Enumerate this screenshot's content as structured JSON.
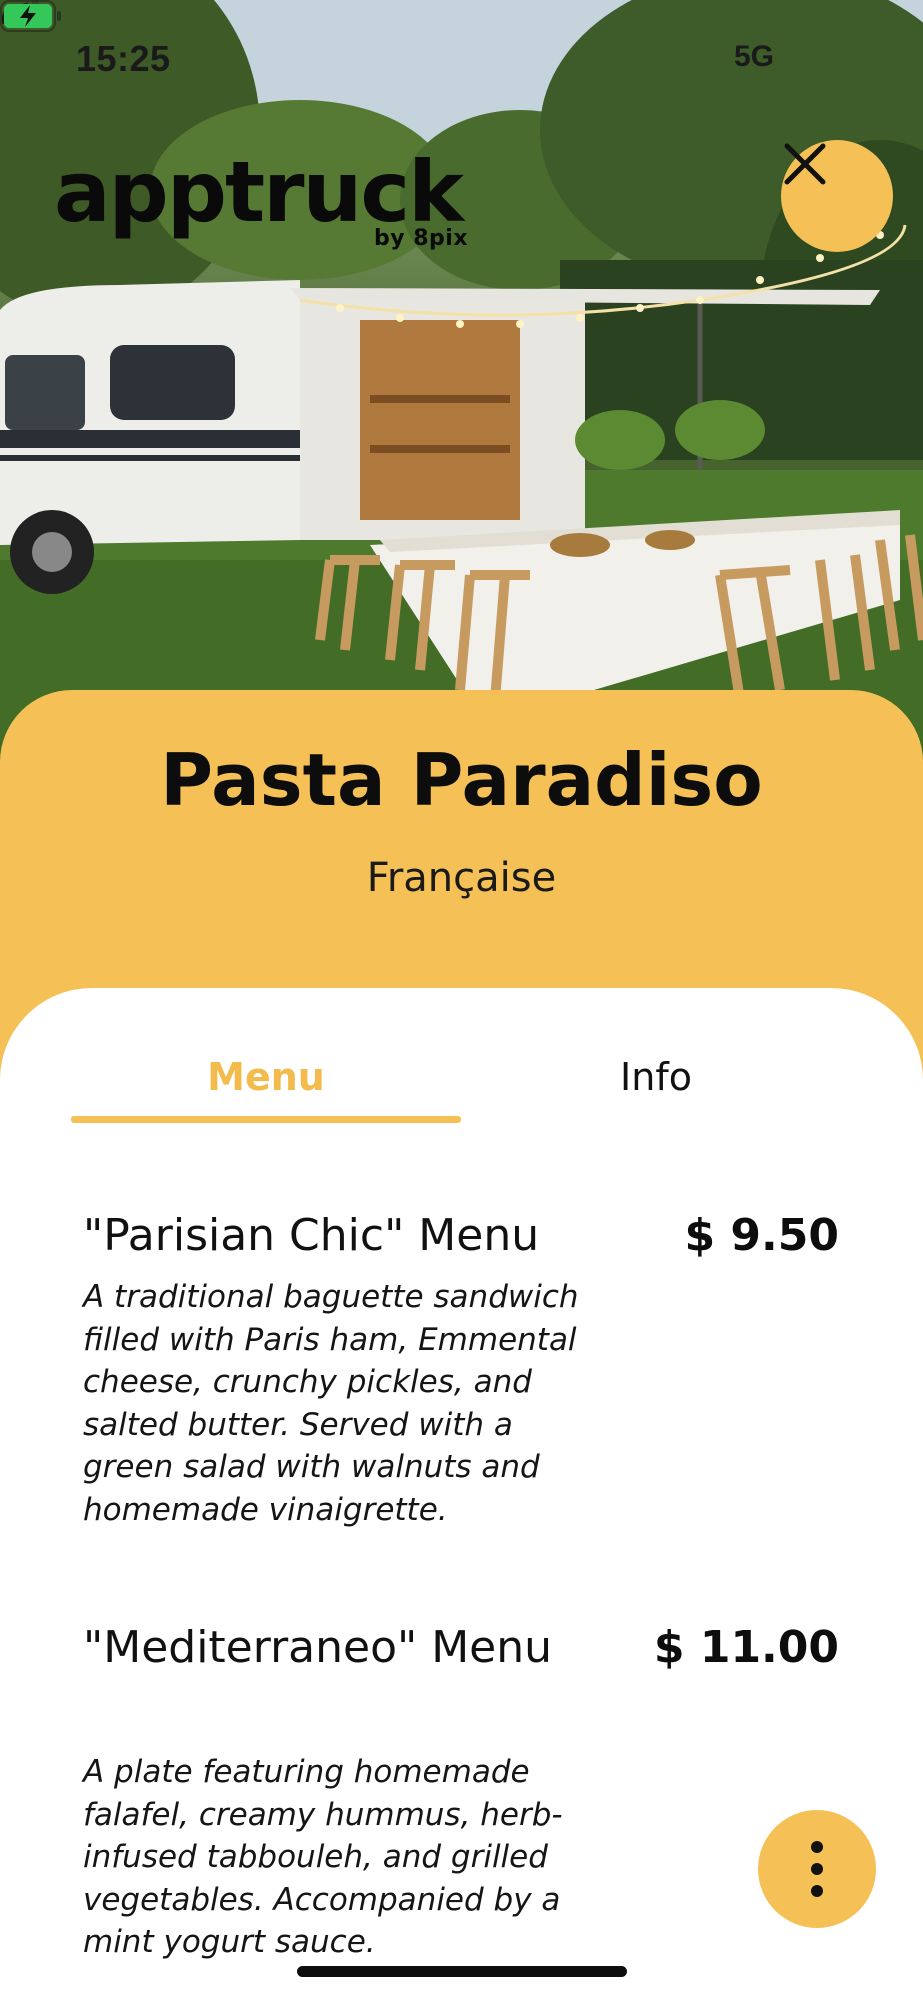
{
  "status_bar": {
    "time": "15:25",
    "network": "5G"
  },
  "brand": {
    "name": "apptruck",
    "by": "by 8pix"
  },
  "header": {
    "title": "Pasta Paradiso",
    "subtitle": "Française"
  },
  "tabs": [
    {
      "label": "Menu",
      "active": true
    },
    {
      "label": "Info",
      "active": false
    }
  ],
  "menu_items": [
    {
      "name": "\"Parisian Chic\" Menu",
      "price": "$ 9.50",
      "description": "A traditional baguette sandwich filled with Paris ham, Emmental cheese, crunchy pickles, and salted butter. Served with a green salad with walnuts and homemade vinaigrette."
    },
    {
      "name": "\"Mediterraneo\" Menu",
      "price": "$ 11.00",
      "description": "A plate featuring homemade falafel, creamy hummus, herb-infused tabbouleh, and grilled vegetables. Accompanied by a mint yogurt sauce."
    }
  ],
  "colors": {
    "accent": "#f5c157",
    "tab_active": "#f2bb4c"
  },
  "icons": {
    "close": "close-icon",
    "more": "more-vertical-icon",
    "location": "location-arrow-icon",
    "signal": "cellular-signal-icon",
    "battery": "battery-charging-icon"
  }
}
